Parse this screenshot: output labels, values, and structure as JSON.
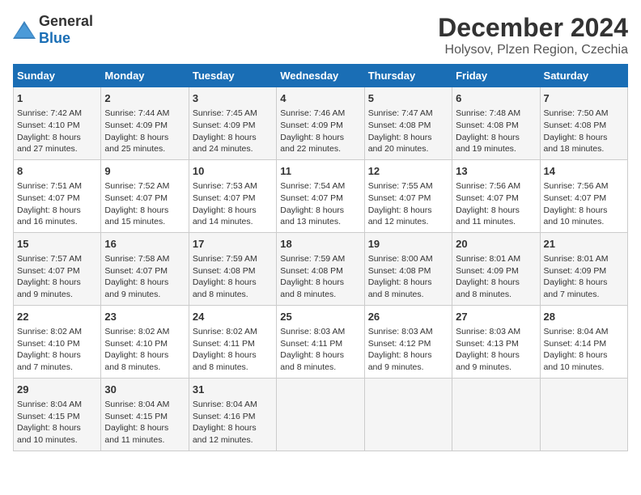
{
  "header": {
    "logo_general": "General",
    "logo_blue": "Blue",
    "month": "December 2024",
    "location": "Holysov, Plzen Region, Czechia"
  },
  "days_of_week": [
    "Sunday",
    "Monday",
    "Tuesday",
    "Wednesday",
    "Thursday",
    "Friday",
    "Saturday"
  ],
  "weeks": [
    [
      {
        "day": "1",
        "lines": [
          "Sunrise: 7:42 AM",
          "Sunset: 4:10 PM",
          "Daylight: 8 hours",
          "and 27 minutes."
        ]
      },
      {
        "day": "2",
        "lines": [
          "Sunrise: 7:44 AM",
          "Sunset: 4:09 PM",
          "Daylight: 8 hours",
          "and 25 minutes."
        ]
      },
      {
        "day": "3",
        "lines": [
          "Sunrise: 7:45 AM",
          "Sunset: 4:09 PM",
          "Daylight: 8 hours",
          "and 24 minutes."
        ]
      },
      {
        "day": "4",
        "lines": [
          "Sunrise: 7:46 AM",
          "Sunset: 4:09 PM",
          "Daylight: 8 hours",
          "and 22 minutes."
        ]
      },
      {
        "day": "5",
        "lines": [
          "Sunrise: 7:47 AM",
          "Sunset: 4:08 PM",
          "Daylight: 8 hours",
          "and 20 minutes."
        ]
      },
      {
        "day": "6",
        "lines": [
          "Sunrise: 7:48 AM",
          "Sunset: 4:08 PM",
          "Daylight: 8 hours",
          "and 19 minutes."
        ]
      },
      {
        "day": "7",
        "lines": [
          "Sunrise: 7:50 AM",
          "Sunset: 4:08 PM",
          "Daylight: 8 hours",
          "and 18 minutes."
        ]
      }
    ],
    [
      {
        "day": "8",
        "lines": [
          "Sunrise: 7:51 AM",
          "Sunset: 4:07 PM",
          "Daylight: 8 hours",
          "and 16 minutes."
        ]
      },
      {
        "day": "9",
        "lines": [
          "Sunrise: 7:52 AM",
          "Sunset: 4:07 PM",
          "Daylight: 8 hours",
          "and 15 minutes."
        ]
      },
      {
        "day": "10",
        "lines": [
          "Sunrise: 7:53 AM",
          "Sunset: 4:07 PM",
          "Daylight: 8 hours",
          "and 14 minutes."
        ]
      },
      {
        "day": "11",
        "lines": [
          "Sunrise: 7:54 AM",
          "Sunset: 4:07 PM",
          "Daylight: 8 hours",
          "and 13 minutes."
        ]
      },
      {
        "day": "12",
        "lines": [
          "Sunrise: 7:55 AM",
          "Sunset: 4:07 PM",
          "Daylight: 8 hours",
          "and 12 minutes."
        ]
      },
      {
        "day": "13",
        "lines": [
          "Sunrise: 7:56 AM",
          "Sunset: 4:07 PM",
          "Daylight: 8 hours",
          "and 11 minutes."
        ]
      },
      {
        "day": "14",
        "lines": [
          "Sunrise: 7:56 AM",
          "Sunset: 4:07 PM",
          "Daylight: 8 hours",
          "and 10 minutes."
        ]
      }
    ],
    [
      {
        "day": "15",
        "lines": [
          "Sunrise: 7:57 AM",
          "Sunset: 4:07 PM",
          "Daylight: 8 hours",
          "and 9 minutes."
        ]
      },
      {
        "day": "16",
        "lines": [
          "Sunrise: 7:58 AM",
          "Sunset: 4:07 PM",
          "Daylight: 8 hours",
          "and 9 minutes."
        ]
      },
      {
        "day": "17",
        "lines": [
          "Sunrise: 7:59 AM",
          "Sunset: 4:08 PM",
          "Daylight: 8 hours",
          "and 8 minutes."
        ]
      },
      {
        "day": "18",
        "lines": [
          "Sunrise: 7:59 AM",
          "Sunset: 4:08 PM",
          "Daylight: 8 hours",
          "and 8 minutes."
        ]
      },
      {
        "day": "19",
        "lines": [
          "Sunrise: 8:00 AM",
          "Sunset: 4:08 PM",
          "Daylight: 8 hours",
          "and 8 minutes."
        ]
      },
      {
        "day": "20",
        "lines": [
          "Sunrise: 8:01 AM",
          "Sunset: 4:09 PM",
          "Daylight: 8 hours",
          "and 8 minutes."
        ]
      },
      {
        "day": "21",
        "lines": [
          "Sunrise: 8:01 AM",
          "Sunset: 4:09 PM",
          "Daylight: 8 hours",
          "and 7 minutes."
        ]
      }
    ],
    [
      {
        "day": "22",
        "lines": [
          "Sunrise: 8:02 AM",
          "Sunset: 4:10 PM",
          "Daylight: 8 hours",
          "and 7 minutes."
        ]
      },
      {
        "day": "23",
        "lines": [
          "Sunrise: 8:02 AM",
          "Sunset: 4:10 PM",
          "Daylight: 8 hours",
          "and 8 minutes."
        ]
      },
      {
        "day": "24",
        "lines": [
          "Sunrise: 8:02 AM",
          "Sunset: 4:11 PM",
          "Daylight: 8 hours",
          "and 8 minutes."
        ]
      },
      {
        "day": "25",
        "lines": [
          "Sunrise: 8:03 AM",
          "Sunset: 4:11 PM",
          "Daylight: 8 hours",
          "and 8 minutes."
        ]
      },
      {
        "day": "26",
        "lines": [
          "Sunrise: 8:03 AM",
          "Sunset: 4:12 PM",
          "Daylight: 8 hours",
          "and 9 minutes."
        ]
      },
      {
        "day": "27",
        "lines": [
          "Sunrise: 8:03 AM",
          "Sunset: 4:13 PM",
          "Daylight: 8 hours",
          "and 9 minutes."
        ]
      },
      {
        "day": "28",
        "lines": [
          "Sunrise: 8:04 AM",
          "Sunset: 4:14 PM",
          "Daylight: 8 hours",
          "and 10 minutes."
        ]
      }
    ],
    [
      {
        "day": "29",
        "lines": [
          "Sunrise: 8:04 AM",
          "Sunset: 4:15 PM",
          "Daylight: 8 hours",
          "and 10 minutes."
        ]
      },
      {
        "day": "30",
        "lines": [
          "Sunrise: 8:04 AM",
          "Sunset: 4:15 PM",
          "Daylight: 8 hours",
          "and 11 minutes."
        ]
      },
      {
        "day": "31",
        "lines": [
          "Sunrise: 8:04 AM",
          "Sunset: 4:16 PM",
          "Daylight: 8 hours",
          "and 12 minutes."
        ]
      },
      null,
      null,
      null,
      null
    ]
  ]
}
